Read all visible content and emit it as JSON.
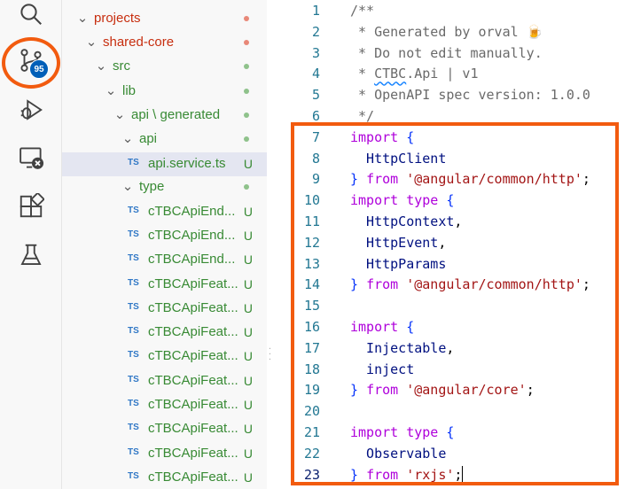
{
  "activity_bar": {
    "items": [
      "search-icon",
      "source-control-icon",
      "run-debug-icon",
      "remote-explorer-icon",
      "extensions-icon",
      "testing-icon"
    ],
    "scm_badge": "95"
  },
  "explorer": {
    "rows": [
      {
        "label": "projects",
        "status": "",
        "kind": "folder"
      },
      {
        "label": "shared-core",
        "status": "",
        "kind": "folder"
      },
      {
        "label": "src",
        "status": "",
        "kind": "folder"
      },
      {
        "label": "lib",
        "status": "",
        "kind": "folder"
      },
      {
        "label": "api \\ generated",
        "status": "",
        "kind": "folder"
      },
      {
        "label": "api",
        "status": "",
        "kind": "folder"
      },
      {
        "label": "api.service.ts",
        "status": "U",
        "kind": "file",
        "badge": "TS"
      },
      {
        "label": "type",
        "status": "",
        "kind": "folder"
      },
      {
        "label": "cTBCApiEnd...",
        "status": "U",
        "kind": "file",
        "badge": "TS"
      },
      {
        "label": "cTBCApiEnd...",
        "status": "U",
        "kind": "file",
        "badge": "TS"
      },
      {
        "label": "cTBCApiEnd...",
        "status": "U",
        "kind": "file",
        "badge": "TS"
      },
      {
        "label": "cTBCApiFeat...",
        "status": "U",
        "kind": "file",
        "badge": "TS"
      },
      {
        "label": "cTBCApiFeat...",
        "status": "U",
        "kind": "file",
        "badge": "TS"
      },
      {
        "label": "cTBCApiFeat...",
        "status": "U",
        "kind": "file",
        "badge": "TS"
      },
      {
        "label": "cTBCApiFeat...",
        "status": "U",
        "kind": "file",
        "badge": "TS"
      },
      {
        "label": "cTBCApiFeat...",
        "status": "U",
        "kind": "file",
        "badge": "TS"
      },
      {
        "label": "cTBCApiFeat...",
        "status": "U",
        "kind": "file",
        "badge": "TS"
      },
      {
        "label": "cTBCApiFeat...",
        "status": "U",
        "kind": "file",
        "badge": "TS"
      },
      {
        "label": "cTBCApiFeat...",
        "status": "U",
        "kind": "file",
        "badge": "TS"
      },
      {
        "label": "cTBCApiFeat...",
        "status": "U",
        "kind": "file",
        "badge": "TS"
      },
      {
        "label": "cTBCApiFeat...",
        "status": "U",
        "kind": "file",
        "badge": "TS"
      }
    ]
  },
  "editor": {
    "lines": [
      {
        "n": "1",
        "tokens": [
          [
            "cmt",
            "/**"
          ]
        ]
      },
      {
        "n": "2",
        "tokens": [
          [
            "cmt",
            " * Generated by orval 🍺"
          ]
        ]
      },
      {
        "n": "3",
        "tokens": [
          [
            "cmt",
            " * Do not edit manually."
          ]
        ]
      },
      {
        "n": "4",
        "tokens": [
          [
            "cmt",
            " * "
          ],
          [
            "squig",
            "CTBC"
          ],
          [
            "cmt",
            ".Api | v1"
          ]
        ]
      },
      {
        "n": "5",
        "tokens": [
          [
            "cmt",
            " * OpenAPI spec version: 1.0.0"
          ]
        ]
      },
      {
        "n": "6",
        "tokens": [
          [
            "cmt",
            " */"
          ]
        ]
      },
      {
        "n": "7",
        "tokens": [
          [
            "kw",
            "import"
          ],
          [
            "punc",
            " "
          ],
          [
            "brace",
            "{"
          ]
        ]
      },
      {
        "n": "8",
        "tokens": [
          [
            "id",
            "  HttpClient"
          ]
        ]
      },
      {
        "n": "9",
        "tokens": [
          [
            "brace",
            "}"
          ],
          [
            "punc",
            " "
          ],
          [
            "kw",
            "from"
          ],
          [
            "punc",
            " "
          ],
          [
            "str",
            "'@angular/common/http'"
          ],
          [
            "punc",
            ";"
          ]
        ]
      },
      {
        "n": "10",
        "tokens": [
          [
            "kw",
            "import"
          ],
          [
            "punc",
            " "
          ],
          [
            "kw",
            "type"
          ],
          [
            "punc",
            " "
          ],
          [
            "brace",
            "{"
          ]
        ]
      },
      {
        "n": "11",
        "tokens": [
          [
            "id",
            "  HttpContext"
          ],
          [
            "punc",
            ","
          ]
        ]
      },
      {
        "n": "12",
        "tokens": [
          [
            "id",
            "  HttpEvent"
          ],
          [
            "punc",
            ","
          ]
        ]
      },
      {
        "n": "13",
        "tokens": [
          [
            "id",
            "  HttpParams"
          ]
        ]
      },
      {
        "n": "14",
        "tokens": [
          [
            "brace",
            "}"
          ],
          [
            "punc",
            " "
          ],
          [
            "kw",
            "from"
          ],
          [
            "punc",
            " "
          ],
          [
            "str",
            "'@angular/common/http'"
          ],
          [
            "punc",
            ";"
          ]
        ]
      },
      {
        "n": "15",
        "tokens": []
      },
      {
        "n": "16",
        "tokens": [
          [
            "kw",
            "import"
          ],
          [
            "punc",
            " "
          ],
          [
            "brace",
            "{"
          ]
        ]
      },
      {
        "n": "17",
        "tokens": [
          [
            "id",
            "  Injectable"
          ],
          [
            "punc",
            ","
          ]
        ]
      },
      {
        "n": "18",
        "tokens": [
          [
            "id",
            "  inject"
          ]
        ]
      },
      {
        "n": "19",
        "tokens": [
          [
            "brace",
            "}"
          ],
          [
            "punc",
            " "
          ],
          [
            "kw",
            "from"
          ],
          [
            "punc",
            " "
          ],
          [
            "str",
            "'@angular/core'"
          ],
          [
            "punc",
            ";"
          ]
        ]
      },
      {
        "n": "20",
        "tokens": []
      },
      {
        "n": "21",
        "tokens": [
          [
            "kw",
            "import"
          ],
          [
            "punc",
            " "
          ],
          [
            "kw",
            "type"
          ],
          [
            "punc",
            " "
          ],
          [
            "brace",
            "{"
          ]
        ]
      },
      {
        "n": "22",
        "tokens": [
          [
            "id",
            "  Observable"
          ]
        ]
      },
      {
        "n": "23",
        "tokens": [
          [
            "brace",
            "}"
          ],
          [
            "punc",
            " "
          ],
          [
            "kw",
            "from"
          ],
          [
            "punc",
            " "
          ],
          [
            "str",
            "'rxjs'"
          ],
          [
            "punc",
            ";"
          ]
        ]
      }
    ],
    "active_line": "23"
  },
  "colors": {
    "highlight_box": "#f25b0f",
    "scm_badge": "#005fb8",
    "untracked_green": "#388a34",
    "folder_modified_red": "#c72e0f"
  }
}
